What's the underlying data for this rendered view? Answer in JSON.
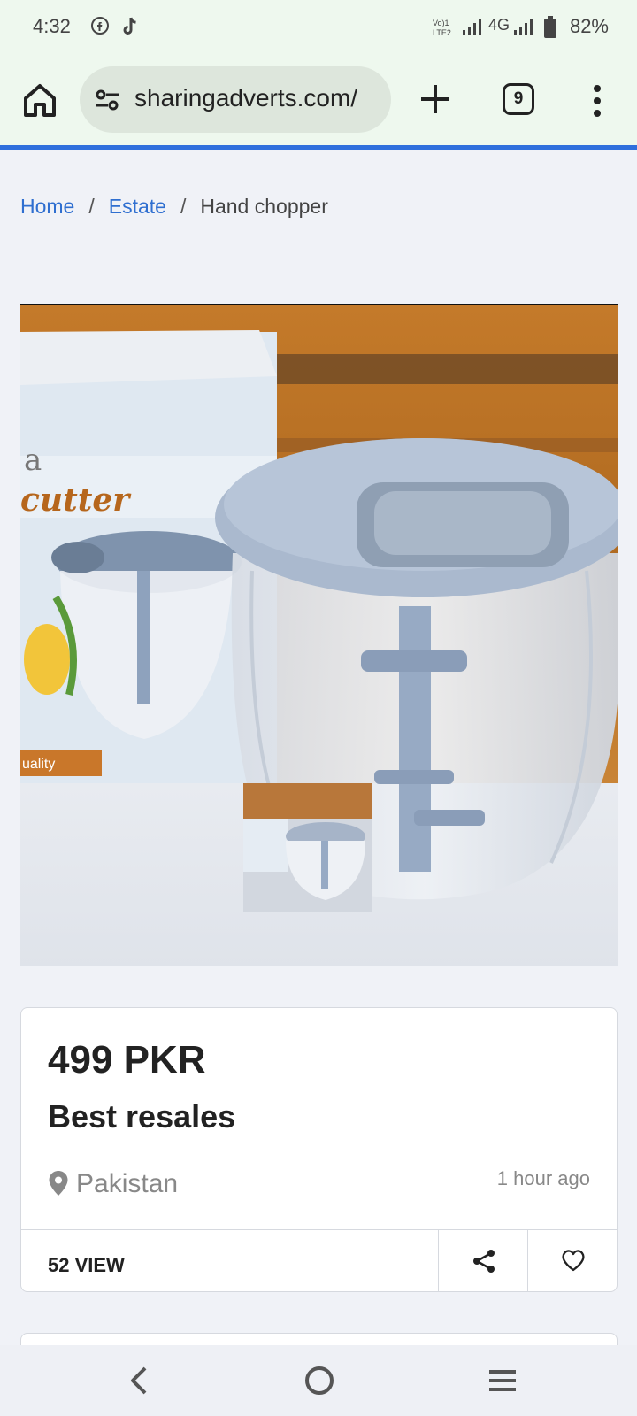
{
  "status_bar": {
    "time": "4:32",
    "network_label": "4G",
    "battery": "82%",
    "icons": [
      "facebook-icon",
      "tiktok-icon",
      "volte-icon",
      "signal-icon",
      "battery-icon"
    ]
  },
  "browser": {
    "url": "sharingadverts.com/",
    "tab_count": "9",
    "accent_color": "#2f6fdc"
  },
  "breadcrumb": {
    "items": [
      {
        "label": "Home"
      },
      {
        "label": "Estate"
      }
    ],
    "separator": "/",
    "current": "Hand chopper"
  },
  "listing": {
    "price": "499 PKR",
    "title": "Best resales",
    "location": "Pakistan",
    "posted": "1 hour ago",
    "views": "52 VIEW"
  }
}
